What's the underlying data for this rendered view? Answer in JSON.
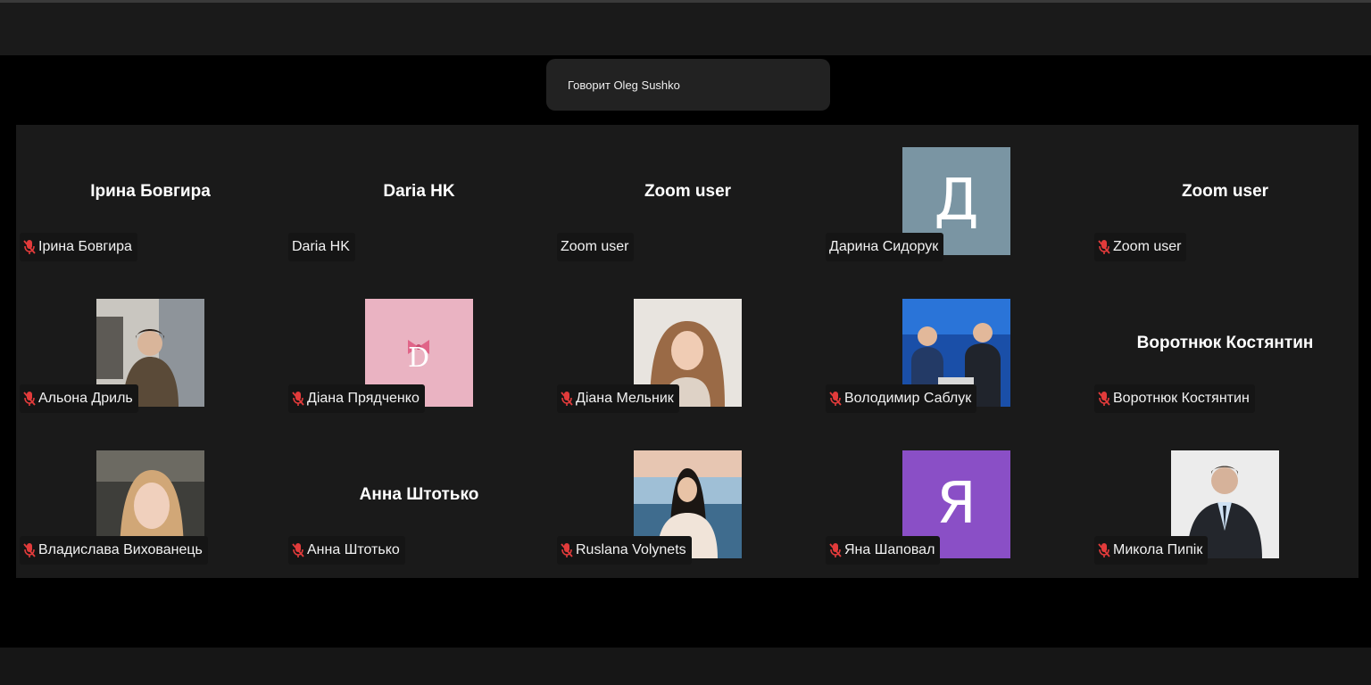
{
  "speaker_banner": "Говорит Oleg Sushko",
  "colors": {
    "background": "#000000",
    "gallery": "#1a1a1a",
    "mic_off": "#e23b3b",
    "avatar_d": "#7a95a3",
    "avatar_ya": "#8a4fc6"
  },
  "participants": [
    {
      "id": "irina",
      "display": "name",
      "center_name": "Ірина Бовгира",
      "label": "Ірина Бовгира",
      "muted": true
    },
    {
      "id": "daria",
      "display": "name",
      "center_name": "Daria HK",
      "label": "Daria HK",
      "muted": false
    },
    {
      "id": "zoom1",
      "display": "name",
      "center_name": "Zoom user",
      "label": "Zoom user",
      "muted": false
    },
    {
      "id": "daryna",
      "display": "letter",
      "letter": "Д",
      "label": "Дарина Сидорук",
      "muted": false
    },
    {
      "id": "zoom2",
      "display": "name",
      "center_name": "Zoom user",
      "label": "Zoom user",
      "muted": true
    },
    {
      "id": "alona",
      "display": "photo",
      "photo_icon": "person-photo-icon",
      "label": "Альона Дриль",
      "muted": true
    },
    {
      "id": "diana-p",
      "display": "photo",
      "photo_icon": "bow-logo-icon",
      "label": "Діана Прядченко",
      "muted": true
    },
    {
      "id": "diana-m",
      "display": "photo",
      "photo_icon": "person-photo-icon",
      "label": "Діана Мельник",
      "muted": true
    },
    {
      "id": "volodymyr",
      "display": "photo",
      "photo_icon": "two-people-photo-icon",
      "label": "Володимир Саблук",
      "muted": true
    },
    {
      "id": "vorotniuk",
      "display": "name",
      "center_name": "Воротнюк Костянтин",
      "label": "Воротнюк Костянтин",
      "muted": true
    },
    {
      "id": "vladyslava",
      "display": "photo",
      "photo_icon": "person-photo-icon",
      "label": "Владислава Вихованець",
      "muted": true
    },
    {
      "id": "anna",
      "display": "name",
      "center_name": "Анна Штотько",
      "label": "Анна Штотько",
      "muted": true
    },
    {
      "id": "ruslana",
      "display": "photo",
      "photo_icon": "person-photo-icon",
      "label": "Ruslana Volynets",
      "muted": true
    },
    {
      "id": "yana",
      "display": "letter",
      "letter": "Я",
      "label": "Яна Шаповал",
      "muted": true
    },
    {
      "id": "mykola",
      "display": "photo",
      "photo_icon": "person-photo-icon",
      "label": "Микола Пипік",
      "muted": true
    }
  ]
}
